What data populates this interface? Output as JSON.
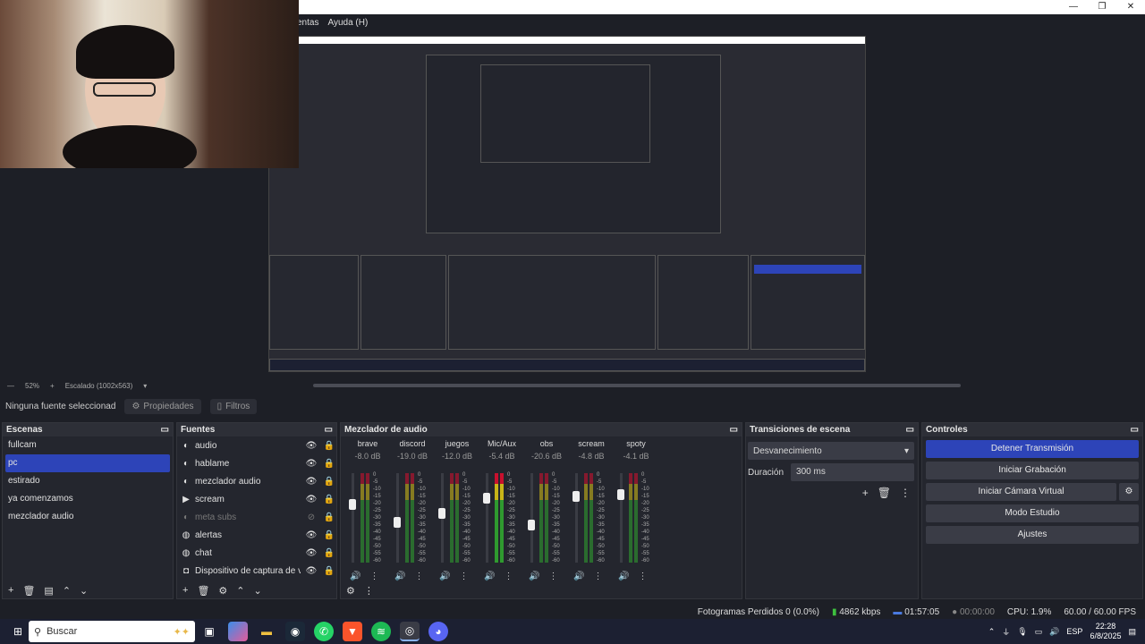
{
  "menu": {
    "items": [
      "entas",
      "Ayuda (H)"
    ]
  },
  "window_controls": [
    "—",
    "❐",
    "✕"
  ],
  "scale": {
    "zoom": "52%",
    "mode": "Escalado (1002x563)"
  },
  "source_info": {
    "selected": "Ninguna fuente seleccionad",
    "properties": "Propiedades",
    "filters": "Filtros"
  },
  "scenes": {
    "title": "Escenas",
    "items": [
      "fullcam",
      "pc",
      "estirado",
      "ya comenzamos",
      "mezclador audio"
    ],
    "selected_index": 1
  },
  "sources": {
    "title": "Fuentes",
    "items": [
      {
        "label": "audio",
        "icon": "audio-source-icon",
        "visible": true
      },
      {
        "label": "hablame",
        "icon": "audio-source-icon",
        "visible": true
      },
      {
        "label": "mezclador audio",
        "icon": "audio-source-icon",
        "visible": true
      },
      {
        "label": "scream",
        "icon": "media-play-icon",
        "visible": true
      },
      {
        "label": "meta subs",
        "icon": "audio-source-icon",
        "visible": false
      },
      {
        "label": "alertas",
        "icon": "globe-icon",
        "visible": true
      },
      {
        "label": "chat",
        "icon": "globe-icon",
        "visible": true
      },
      {
        "label": "Dispositivo de captura de vi",
        "icon": "camera-icon",
        "visible": true
      }
    ]
  },
  "mixer": {
    "title": "Mezclador de audio",
    "channels": [
      {
        "name": "brave",
        "db": "-8.0 dB",
        "level": 0.65
      },
      {
        "name": "discord",
        "db": "-19.0 dB",
        "level": 0.45
      },
      {
        "name": "juegos",
        "db": "-12.0 dB",
        "level": 0.55
      },
      {
        "name": "Mic/Aux",
        "db": "-5.4 dB",
        "level": 0.72
      },
      {
        "name": "obs",
        "db": "-20.6 dB",
        "level": 0.42
      },
      {
        "name": "scream",
        "db": "-4.8 dB",
        "level": 0.74
      },
      {
        "name": "spoty",
        "db": "-4.1 dB",
        "level": 0.76
      }
    ],
    "scale_marks": [
      "0",
      "-5",
      "-10",
      "-15",
      "-20",
      "-25",
      "-30",
      "-35",
      "-40",
      "-45",
      "-50",
      "-55",
      "-60"
    ]
  },
  "transitions": {
    "title": "Transiciones de escena",
    "type": "Desvanecimiento",
    "duration_label": "Duración",
    "duration_value": "300 ms"
  },
  "controls": {
    "title": "Controles",
    "buttons": [
      "Detener Transmisión",
      "Iniciar Grabación",
      "Iniciar Cámara Virtual",
      "Modo Estudio",
      "Ajustes"
    ]
  },
  "status": {
    "dropped": "Fotogramas Perdidos 0 (0.0%)",
    "bitrate": "4862 kbps",
    "stream_time": "01:57:05",
    "rec_time": "00:00:00",
    "cpu": "CPU: 1.9%",
    "fps": "60.00 / 60.00 FPS"
  },
  "taskbar": {
    "search_placeholder": "Buscar",
    "lang": "ESP",
    "time": "22:28",
    "date": "6/8/2025"
  },
  "colors": {
    "accent": "#2d44b8",
    "bg": "#1d1f26",
    "dock": "#24262e"
  }
}
